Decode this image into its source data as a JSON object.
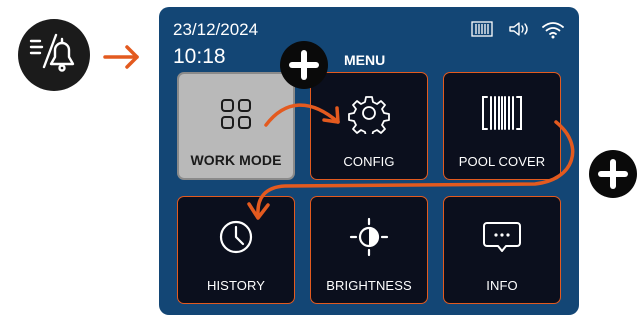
{
  "status": {
    "date": "23/12/2024",
    "time": "10:18",
    "menu_title": "MENU",
    "icons": [
      "pool-cover-status-icon",
      "volume-icon",
      "wifi-icon"
    ]
  },
  "tiles": [
    {
      "label": "WORK MODE",
      "icon": "grid-icon",
      "selected": true
    },
    {
      "label": "CONFIG",
      "icon": "gear-icon",
      "selected": false
    },
    {
      "label": "POOL COVER",
      "icon": "pool-cover-icon",
      "selected": false
    },
    {
      "label": "HISTORY",
      "icon": "clock-icon",
      "selected": false
    },
    {
      "label": "BRIGHTNESS",
      "icon": "brightness-icon",
      "selected": false
    },
    {
      "label": "INFO",
      "icon": "message-icon",
      "selected": false
    }
  ],
  "annotations": {
    "menu_button_icon": "menu-bell-icon",
    "plus_icon": "plus-icon",
    "accent_color": "#e35a1f",
    "screen_color": "#134675"
  }
}
